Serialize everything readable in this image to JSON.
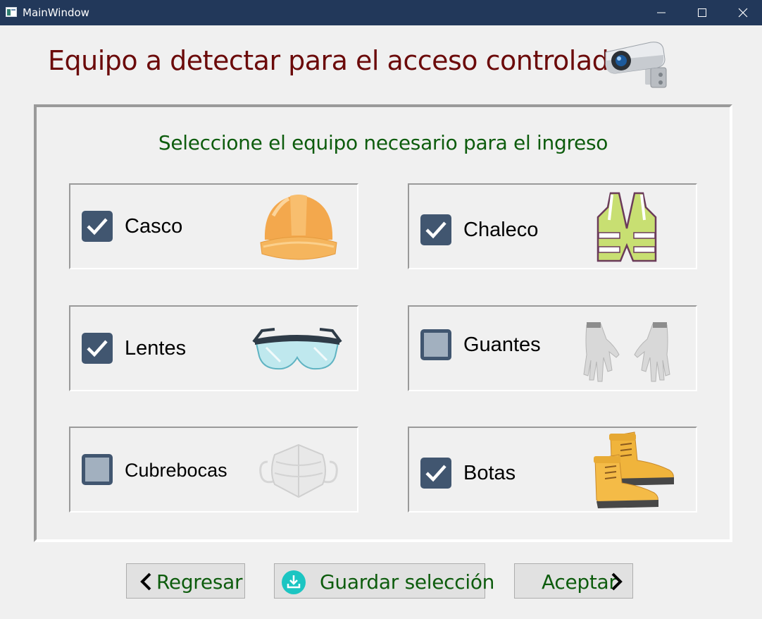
{
  "window": {
    "title": "MainWindow",
    "controls": [
      "minimize-icon",
      "maximize-icon",
      "close-icon"
    ]
  },
  "header": {
    "title": "Equipo a detectar para el acceso controlado",
    "icon": "security-camera-icon"
  },
  "panel": {
    "subtitle": "Seleccione el equipo necesario para el ingreso",
    "items": [
      {
        "label": "Casco",
        "checked": true,
        "icon": "hard-hat-icon"
      },
      {
        "label": "Chaleco",
        "checked": true,
        "icon": "safety-vest-icon"
      },
      {
        "label": "Lentes",
        "checked": true,
        "icon": "safety-glasses-icon"
      },
      {
        "label": "Guantes",
        "checked": false,
        "icon": "gloves-icon"
      },
      {
        "label": "Cubrebocas",
        "checked": false,
        "icon": "face-mask-icon"
      },
      {
        "label": "Botas",
        "checked": true,
        "icon": "boots-icon"
      }
    ]
  },
  "buttons": {
    "back": "Regresar",
    "save": "Guardar selección",
    "accept": "Aceptar"
  },
  "colors": {
    "titlebar": "#22385a",
    "title_text": "#6b0a0a",
    "subtitle_text": "#0d5c0d",
    "checkbox": "#415670"
  }
}
